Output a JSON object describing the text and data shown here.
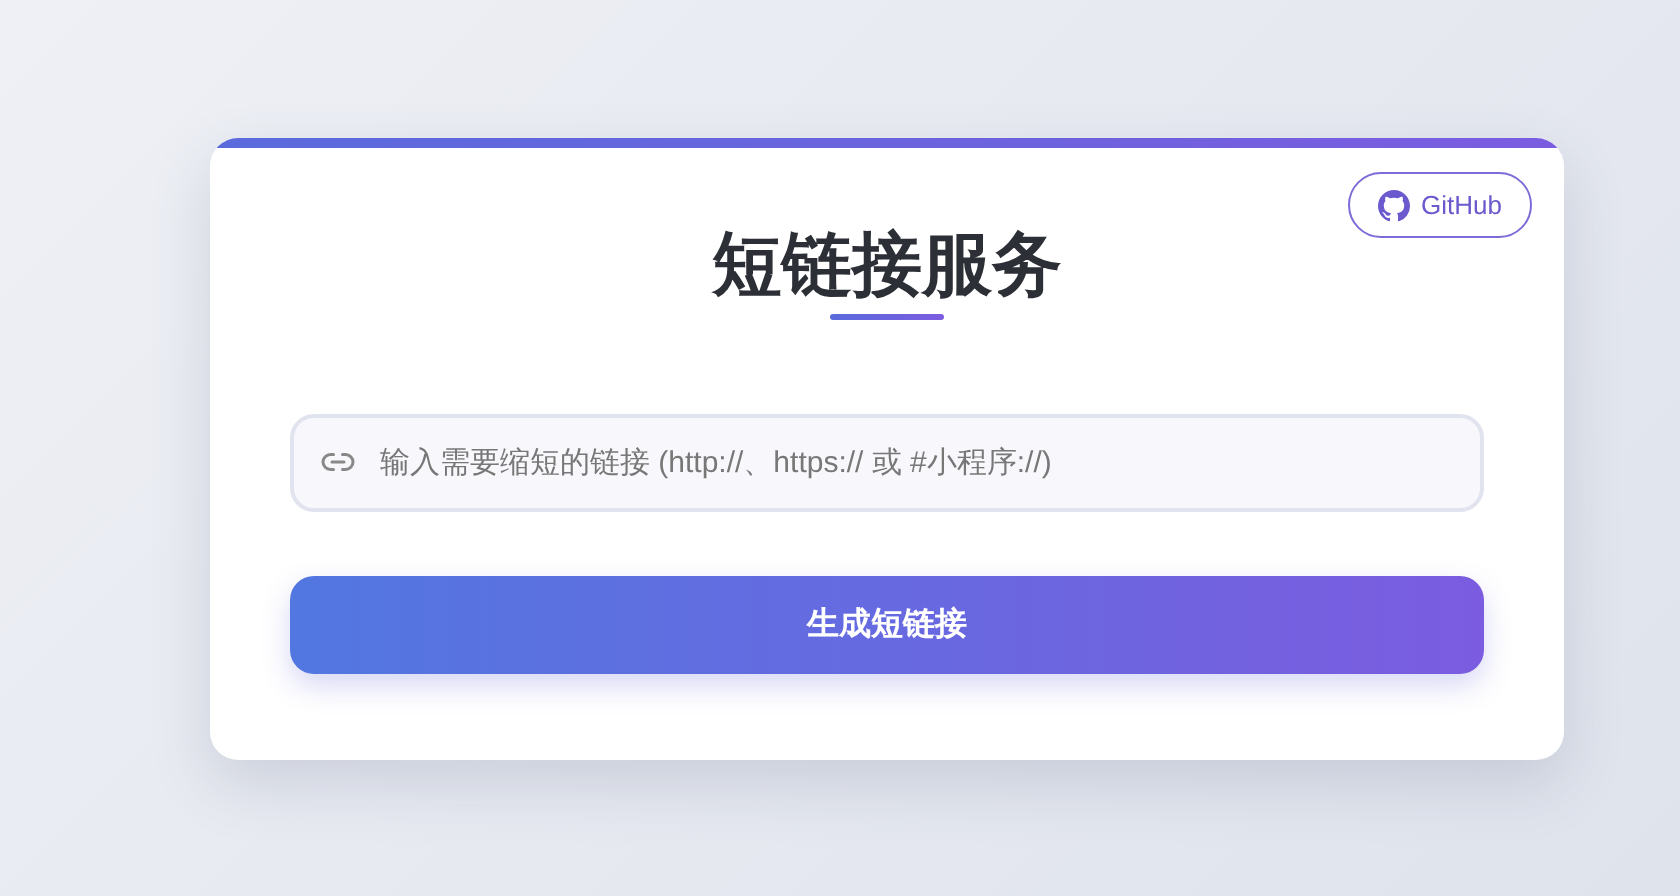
{
  "github_button": {
    "label": "GitHub"
  },
  "title": "短链接服务",
  "url_field": {
    "placeholder": "输入需要缩短的链接 (http://、https:// 或 #小程序://)"
  },
  "submit_button": {
    "label": "生成短链接"
  }
}
